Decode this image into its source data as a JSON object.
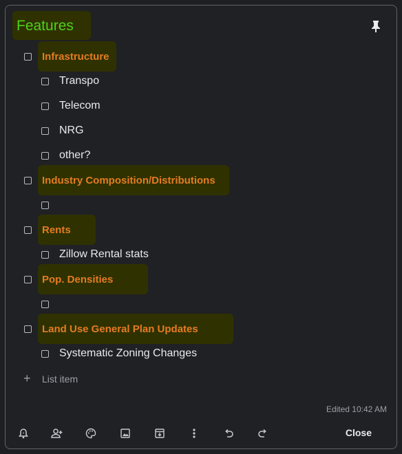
{
  "note": {
    "title": "Features",
    "items": [
      {
        "text": "Infrastructure",
        "heading": true,
        "indent": false
      },
      {
        "text": "Transpo",
        "heading": false,
        "indent": true
      },
      {
        "text": "Telecom",
        "heading": false,
        "indent": true
      },
      {
        "text": "NRG",
        "heading": false,
        "indent": true
      },
      {
        "text": "other?",
        "heading": false,
        "indent": true
      },
      {
        "text": "Industry Composition/Distributions",
        "heading": true,
        "indent": false
      },
      {
        "text": "",
        "heading": false,
        "indent": true
      },
      {
        "text": "Rents",
        "heading": true,
        "indent": false
      },
      {
        "text": "Zillow Rental stats",
        "heading": false,
        "indent": true
      },
      {
        "text": "Pop. Densities",
        "heading": true,
        "indent": false
      },
      {
        "text": "",
        "heading": false,
        "indent": true
      },
      {
        "text": "Land  Use General Plan Updates",
        "heading": true,
        "indent": false
      },
      {
        "text": "Systematic Zoning Changes",
        "heading": false,
        "indent": true
      }
    ],
    "add_placeholder": "List item",
    "edited": "Edited 10:42 AM"
  },
  "toolbar": {
    "icons": [
      "reminder-icon",
      "collaborator-icon",
      "palette-icon",
      "image-icon",
      "archive-icon",
      "more-icon",
      "undo-icon",
      "redo-icon"
    ],
    "close_label": "Close"
  },
  "colors": {
    "title": "#4fd11c",
    "heading": "#e47b23",
    "highlight": "#2f3200",
    "background": "#202124"
  }
}
